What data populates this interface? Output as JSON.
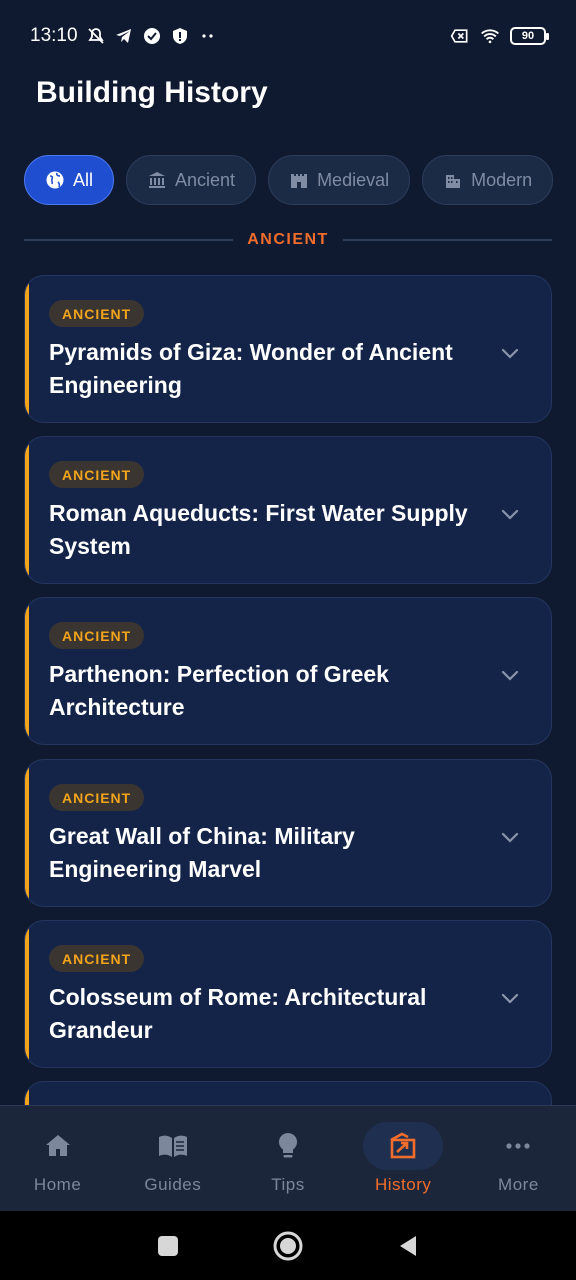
{
  "status_bar": {
    "time": "13:10",
    "battery": "90",
    "icons": [
      "mute-icon",
      "telegram-icon",
      "check-badge-icon",
      "shield-alert-icon",
      "more-dots-icon",
      "sim-x-icon",
      "wifi-icon",
      "battery-icon"
    ]
  },
  "page": {
    "title": "Building History"
  },
  "filters": [
    {
      "label": "All",
      "icon": "globe-icon",
      "active": true
    },
    {
      "label": "Ancient",
      "icon": "columns-icon",
      "active": false
    },
    {
      "label": "Medieval",
      "icon": "castle-icon",
      "active": false
    },
    {
      "label": "Modern",
      "icon": "buildings-icon",
      "active": false
    }
  ],
  "section": {
    "label": "ANCIENT"
  },
  "cards": [
    {
      "badge": "ANCIENT",
      "title": "Pyramids of Giza: Wonder of Ancient Engineering"
    },
    {
      "badge": "ANCIENT",
      "title": "Roman Aqueducts: First Water Supply System"
    },
    {
      "badge": "ANCIENT",
      "title": "Parthenon: Perfection of Greek Architecture"
    },
    {
      "badge": "ANCIENT",
      "title": "Great Wall of China: Military Engineering Marvel"
    },
    {
      "badge": "ANCIENT",
      "title": "Colosseum of Rome: Architectural Grandeur"
    }
  ],
  "bottom_nav": [
    {
      "label": "Home",
      "icon": "home-icon",
      "active": false
    },
    {
      "label": "Guides",
      "icon": "book-icon",
      "active": false
    },
    {
      "label": "Tips",
      "icon": "lightbulb-icon",
      "active": false
    },
    {
      "label": "History",
      "icon": "history-icon",
      "active": true
    },
    {
      "label": "More",
      "icon": "more-icon",
      "active": false
    }
  ],
  "colors": {
    "background": "#0f1a30",
    "accent_orange": "#f26d2b",
    "badge_gold": "#f2a41c",
    "active_chip": "#1f4fd0"
  }
}
